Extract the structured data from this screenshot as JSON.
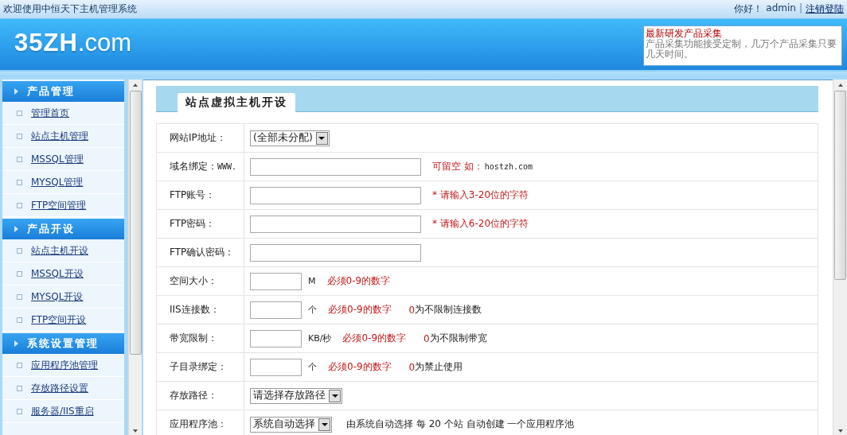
{
  "topbar": {
    "welcome": "欢迎使用中恒天下主机管理系统",
    "greeting": "你好！",
    "user": "admin",
    "separator": "|",
    "logout": "注销登陆"
  },
  "header": {
    "logo": "**35ZH**.com",
    "notice": {
      "title": "最新研发产品采集",
      "body": "产品采集功能接受定制，几万个产品采集只要几天时间。"
    }
  },
  "sidebar": [
    {
      "title": "产品管理",
      "items": [
        {
          "label": "管理首页"
        },
        {
          "label": "站点主机管理"
        },
        {
          "label": "MSSQL管理"
        },
        {
          "label": "MYSQL管理"
        },
        {
          "label": "FTP空间管理"
        }
      ]
    },
    {
      "title": "产品开设",
      "items": [
        {
          "label": "站点主机开设"
        },
        {
          "label": "MSSQL开设"
        },
        {
          "label": "MYSQL开设"
        },
        {
          "label": "FTP空间开设"
        }
      ]
    },
    {
      "title": "系统设置管理",
      "items": [
        {
          "label": "应用程序池管理"
        },
        {
          "label": "存放路径设置"
        },
        {
          "label": "服务器/IIS重启"
        }
      ]
    }
  ],
  "panel": {
    "title": "站点虚拟主机开设"
  },
  "form": [
    {
      "label": "网站IP地址：",
      "kind": "select",
      "value": "(全部未分配)"
    },
    {
      "label": "域名绑定：",
      "prefix": "WWW.",
      "kind": "text",
      "notes": [
        {
          "text": "可留空 如：",
          "kind": "warn"
        },
        {
          "text": "hostzh.com",
          "kind": "mono"
        }
      ]
    },
    {
      "label": "FTP账号：",
      "kind": "text",
      "notes": [
        {
          "text": "* 请输入3-20位的字符",
          "kind": "warn"
        }
      ]
    },
    {
      "label": "FTP密码：",
      "kind": "text",
      "notes": [
        {
          "text": "* 请输入6-20位的字符",
          "kind": "warn"
        }
      ]
    },
    {
      "label": "FTP确认密码：",
      "kind": "text"
    },
    {
      "label": "空间大小：",
      "kind": "text",
      "unit": "M",
      "notes": [
        {
          "text": "必须0-9的数字",
          "kind": "warn"
        }
      ]
    },
    {
      "label": "IIS连接数：",
      "kind": "text",
      "unit": "个",
      "notes": [
        {
          "text": "必须0-9的数字",
          "kind": "warn"
        },
        {
          "text": "0",
          "kind": "warn-gap"
        },
        {
          "text": "为不限制连接数",
          "kind": "plain"
        }
      ]
    },
    {
      "label": "带宽限制：",
      "kind": "text",
      "unit": "KB/秒",
      "notes": [
        {
          "text": "必须0-9的数字",
          "kind": "warn"
        },
        {
          "text": "0",
          "kind": "warn-gap"
        },
        {
          "text": "为不限制带宽",
          "kind": "plain"
        }
      ]
    },
    {
      "label": "子目录绑定：",
      "kind": "text",
      "unit": "个",
      "notes": [
        {
          "text": "必须0-9的数字",
          "kind": "warn"
        },
        {
          "text": "0",
          "kind": "warn-gap"
        },
        {
          "text": "为禁止使用",
          "kind": "plain"
        }
      ]
    },
    {
      "label": "存放路径：",
      "kind": "select",
      "value": "请选择存放路径"
    },
    {
      "label": "应用程序池：",
      "kind": "select",
      "value": "系统自动选择",
      "notes": [
        {
          "text": "由系统自动选择  每 20 个站 自动创建 一个应用程序池",
          "kind": "plain"
        }
      ]
    }
  ]
}
